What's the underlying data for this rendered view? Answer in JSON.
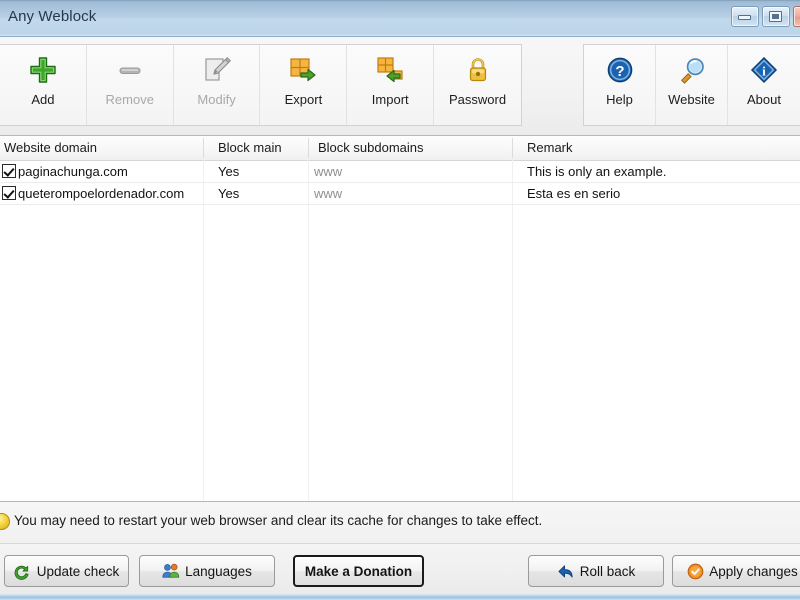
{
  "window": {
    "title": "Any Weblock",
    "controls": [
      {
        "name": "minimize",
        "icon": "minimize-icon"
      },
      {
        "name": "maximize",
        "icon": "maximize-icon"
      },
      {
        "name": "close",
        "icon": "close-icon"
      }
    ]
  },
  "toolbar": {
    "left_group": [
      {
        "label": "Add",
        "icon": "plus-icon",
        "enabled": true
      },
      {
        "label": "Remove",
        "icon": "minus-icon",
        "enabled": false
      },
      {
        "label": "Modify",
        "icon": "pencil-edit-icon",
        "enabled": false
      },
      {
        "label": "Export",
        "icon": "export-arrow-icon",
        "enabled": true
      },
      {
        "label": "Import",
        "icon": "import-arrow-icon",
        "enabled": true
      },
      {
        "label": "Password",
        "icon": "padlock-icon",
        "enabled": true
      }
    ],
    "right_group": [
      {
        "label": "Help",
        "icon": "question-circle-icon",
        "enabled": true
      },
      {
        "label": "Website",
        "icon": "magnifier-icon",
        "enabled": true
      },
      {
        "label": "About",
        "icon": "info-diamond-icon",
        "enabled": true
      }
    ]
  },
  "table": {
    "columns": [
      {
        "label": "Website domain"
      },
      {
        "label": "Block main"
      },
      {
        "label": "Block subdomains"
      },
      {
        "label": "Remark"
      }
    ],
    "rows": [
      {
        "checked": true,
        "domain": "paginachunga.com",
        "block_main": "Yes",
        "block_subdomains": "www",
        "remark": "This is only an example."
      },
      {
        "checked": true,
        "domain": "queterompoelordenador.com",
        "block_main": "Yes",
        "block_subdomains": "www",
        "remark": "Esta es en serio"
      }
    ]
  },
  "status": {
    "icon": "warning-icon",
    "message": "You may need to restart your web browser and clear its cache for changes to take effect."
  },
  "buttons": {
    "update_check": {
      "label": "Update check",
      "icon": "refresh-arrow-icon"
    },
    "languages": {
      "label": "Languages",
      "icon": "people-icon"
    },
    "donation": {
      "label": "Make a Donation"
    },
    "roll_back": {
      "label": "Roll back",
      "icon": "undo-arrow-icon"
    },
    "apply_changes": {
      "label": "Apply changes",
      "icon": "apply-check-icon"
    }
  },
  "colors": {
    "title_bar": "#b8d0e5",
    "accent_green": "#3fa52b",
    "accent_orange": "#f0a030",
    "accent_blue": "#1b63b0",
    "warning_yellow": "#f4d640",
    "subdomain_text": "#8f8f8f"
  }
}
